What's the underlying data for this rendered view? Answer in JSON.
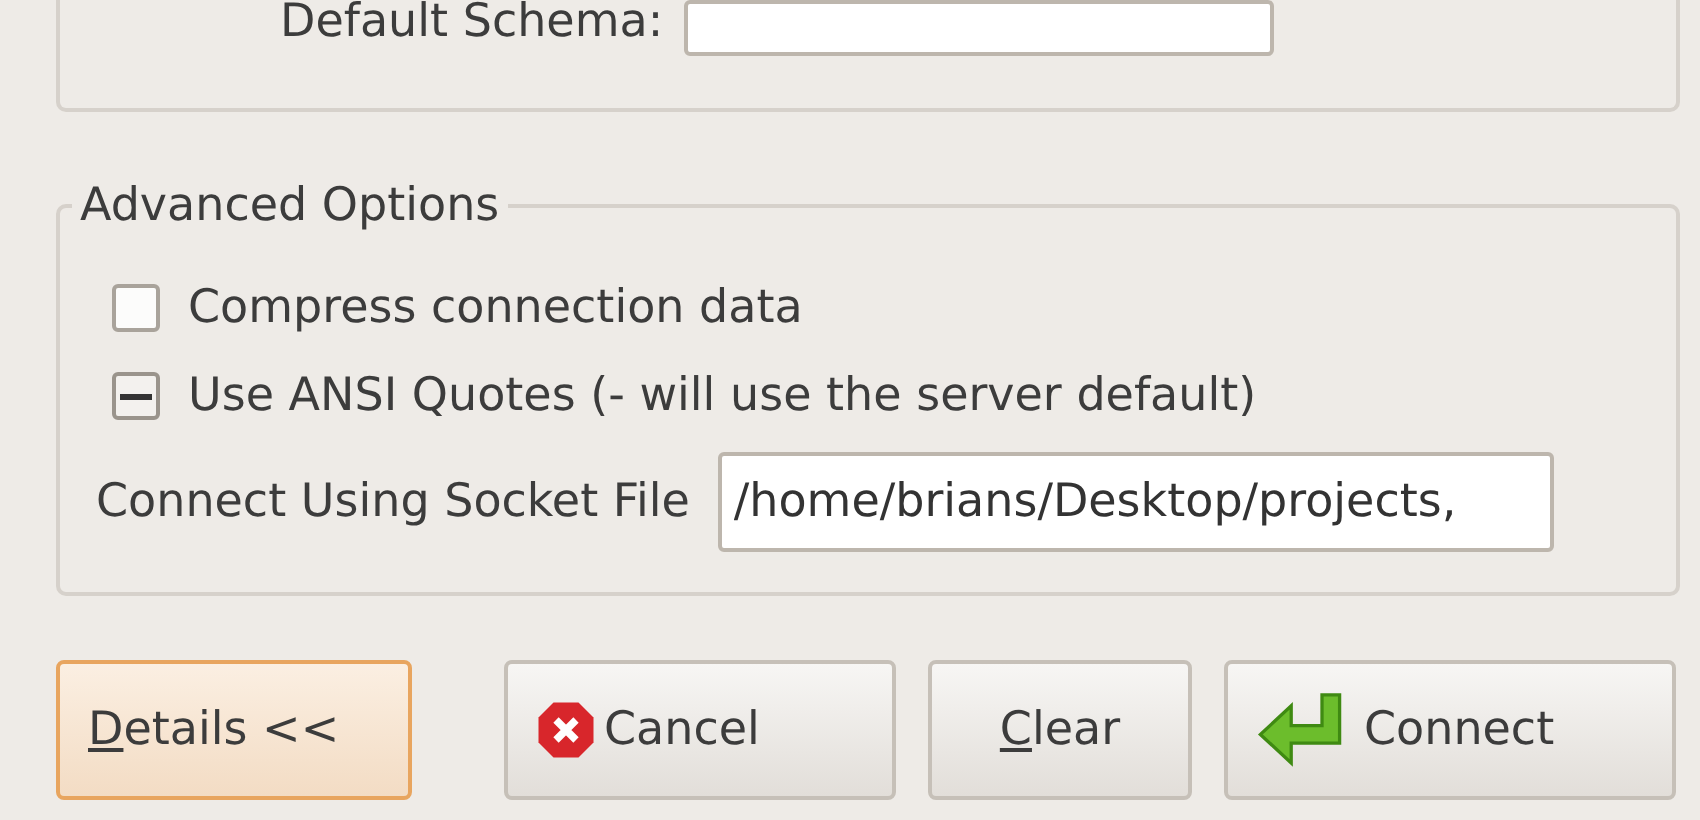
{
  "schema_frame": {
    "label": "Default Schema:"
  },
  "advanced_options": {
    "title": "Advanced Options",
    "checkboxes": [
      {
        "label": "Compress connection data",
        "checked": false,
        "mixed": false
      },
      {
        "label": "Use ANSI Quotes (- will use the server default)",
        "checked": true,
        "mixed": true
      }
    ],
    "socket_file": {
      "label": "Connect Using Socket File",
      "value": "/home/brians/Desktop/projects,"
    }
  },
  "buttons": [
    {
      "label": "Details <<",
      "kind": "plain",
      "underline_first": true,
      "focused": true
    },
    {
      "label": "Cancel",
      "kind": "cancel",
      "underline_first": false,
      "focused": false
    },
    {
      "label": "Clear",
      "kind": "plain",
      "underline_first": true,
      "focused": false
    },
    {
      "label": "Connect",
      "kind": "connect",
      "underline_first": false,
      "focused": false
    }
  ]
}
